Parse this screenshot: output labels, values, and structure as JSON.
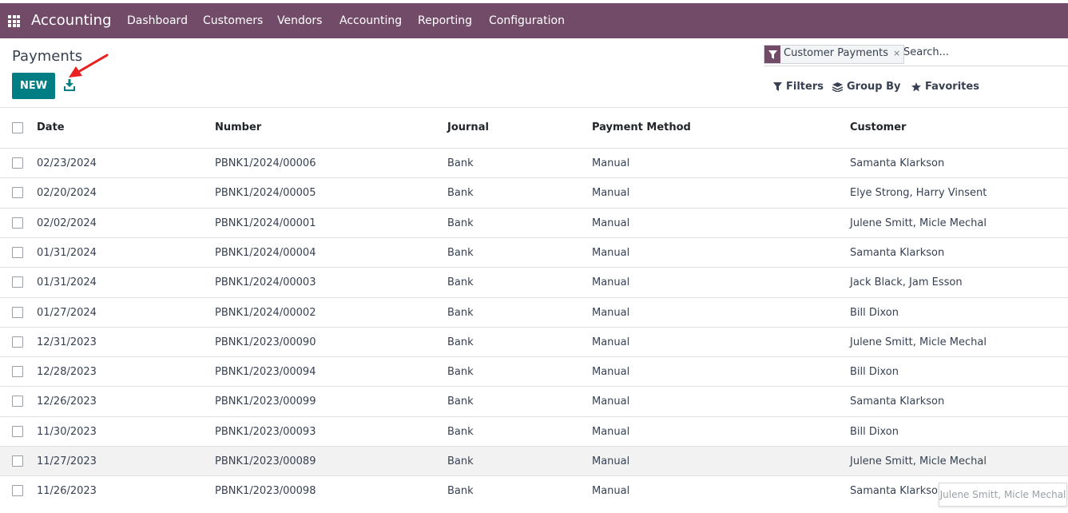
{
  "navbar": {
    "app_title": "Accounting",
    "menu": [
      "Dashboard",
      "Customers",
      "Vendors",
      "Accounting",
      "Reporting",
      "Configuration"
    ],
    "bg_color": "#714b67"
  },
  "control_panel": {
    "breadcrumb": "Payments",
    "new_label": "NEW",
    "new_color": "#017e84",
    "download_icon": "download-icon",
    "annotation_arrow_color": "#e8201f"
  },
  "search": {
    "facet_label": "Customer Payments",
    "facet_remove": "×",
    "placeholder": "Search..."
  },
  "filters": {
    "filters_label": "Filters",
    "group_by_label": "Group By",
    "favorites_label": "Favorites"
  },
  "table": {
    "headers": [
      "Date",
      "Number",
      "Journal",
      "Payment Method",
      "Customer"
    ],
    "rows": [
      [
        "02/23/2024",
        "PBNK1/2024/00006",
        "Bank",
        "Manual",
        "Samanta Klarkson"
      ],
      [
        "02/20/2024",
        "PBNK1/2024/00005",
        "Bank",
        "Manual",
        "Elye Strong, Harry Vinsent"
      ],
      [
        "02/02/2024",
        "PBNK1/2024/00001",
        "Bank",
        "Manual",
        "Julene Smitt, Micle Mechal"
      ],
      [
        "01/31/2024",
        "PBNK1/2024/00004",
        "Bank",
        "Manual",
        "Samanta Klarkson"
      ],
      [
        "01/31/2024",
        "PBNK1/2024/00003",
        "Bank",
        "Manual",
        "Jack Black, Jam Esson"
      ],
      [
        "01/27/2024",
        "PBNK1/2024/00002",
        "Bank",
        "Manual",
        "Bill Dixon"
      ],
      [
        "12/31/2023",
        "PBNK1/2023/00090",
        "Bank",
        "Manual",
        "Julene Smitt, Micle Mechal"
      ],
      [
        "12/28/2023",
        "PBNK1/2023/00094",
        "Bank",
        "Manual",
        "Bill Dixon"
      ],
      [
        "12/26/2023",
        "PBNK1/2023/00099",
        "Bank",
        "Manual",
        "Samanta Klarkson"
      ],
      [
        "11/30/2023",
        "PBNK1/2023/00093",
        "Bank",
        "Manual",
        "Bill Dixon"
      ],
      [
        "11/27/2023",
        "PBNK1/2023/00089",
        "Bank",
        "Manual",
        "Julene Smitt, Micle Mechal"
      ],
      [
        "11/26/2023",
        "PBNK1/2023/00098",
        "Bank",
        "Manual",
        "Samanta Klarkson"
      ]
    ],
    "hovered_row": 10
  },
  "tooltip": {
    "text": "Julene Smitt, Micle Mechal"
  }
}
